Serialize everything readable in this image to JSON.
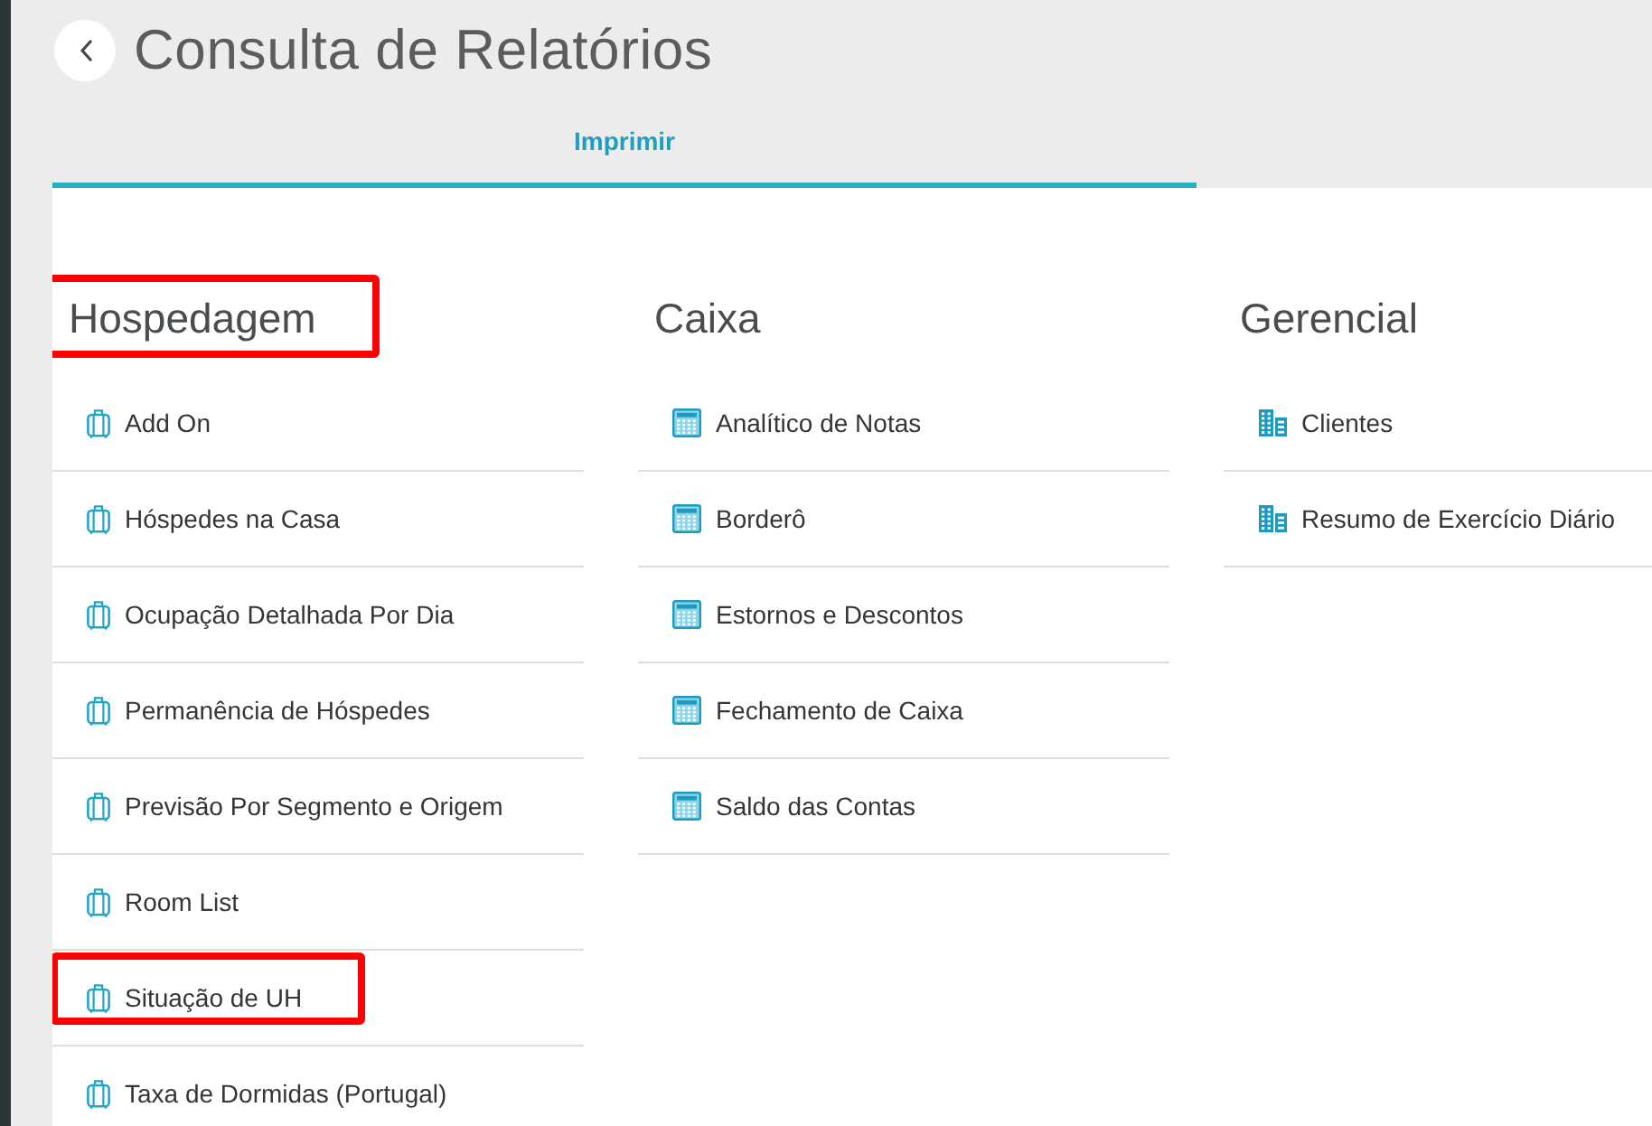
{
  "header": {
    "title": "Consulta de Relatórios"
  },
  "tabs": [
    {
      "label": "Imprimir",
      "selected": true
    }
  ],
  "sections": [
    {
      "heading": "Hospedagem",
      "kind": "lodging",
      "highlighted": true,
      "items": [
        {
          "label": "Add On",
          "highlighted": false
        },
        {
          "label": "Hóspedes na Casa",
          "highlighted": false
        },
        {
          "label": "Ocupação Detalhada Por Dia",
          "highlighted": false
        },
        {
          "label": "Permanência de Hóspedes",
          "highlighted": false
        },
        {
          "label": "Previsão Por Segmento e Origem",
          "highlighted": false
        },
        {
          "label": "Room List",
          "highlighted": false
        },
        {
          "label": "Situação de UH",
          "highlighted": true
        },
        {
          "label": "Taxa de Dormidas (Portugal)",
          "highlighted": false
        }
      ]
    },
    {
      "heading": "Caixa",
      "kind": "cashier",
      "highlighted": false,
      "items": [
        {
          "label": "Analítico de Notas",
          "highlighted": false
        },
        {
          "label": "Borderô",
          "highlighted": false
        },
        {
          "label": "Estornos e Descontos",
          "highlighted": false
        },
        {
          "label": "Fechamento de Caixa",
          "highlighted": false
        },
        {
          "label": "Saldo das Contas",
          "highlighted": false
        }
      ]
    },
    {
      "heading": "Gerencial",
      "kind": "management",
      "highlighted": false,
      "items": [
        {
          "label": "Clientes",
          "highlighted": false
        },
        {
          "label": "Resumo de Exercício Diário",
          "highlighted": false
        }
      ]
    }
  ]
}
